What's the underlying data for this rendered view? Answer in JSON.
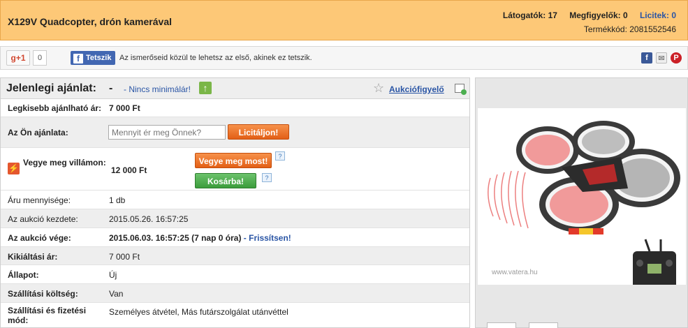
{
  "header": {
    "title": "X129V Quadcopter, drón kamerával",
    "visitors": "Látogatók: 17",
    "watchers": "Megfigyelők: 0",
    "bids": "Licitek: 0",
    "product_code": "Termékkód: 2081552546"
  },
  "social": {
    "gplus_label": "g+1",
    "gplus_count": "0",
    "fb_label": "Tetszik",
    "fb_icon": "f",
    "fb_text": "Az ismerőseid közül te lehetsz az első, akinek ez tetszik.",
    "share_fb": "f",
    "share_mail": "✉",
    "share_pin": "P"
  },
  "bid": {
    "current_label": "Jelenlegi ajánlat:",
    "current_value": "-",
    "no_minimum": "- Nincs minimálár!",
    "watch_label": "Aukciófigyelő",
    "min_bid_label": "Legkisebb ajánlható ár:",
    "min_bid_value": "7 000 Ft",
    "your_bid_label": "Az Ön ajánlata:",
    "your_bid_placeholder": "Mennyit ér meg Önnek?",
    "bid_button": "Licitáljon!",
    "buynow_label": "Vegye meg villámon:",
    "buynow_value": "12 000 Ft",
    "buynow_button": "Vegye meg most!",
    "cart_button": "Kosárba!",
    "help_mark": "?"
  },
  "details": [
    {
      "label": "Áru mennyisége:",
      "value": "1 db"
    },
    {
      "label": "Az aukció kezdete:",
      "value": "2015.05.26. 16:57:25"
    },
    {
      "label": "Az aukció vége:",
      "value": "2015.06.03. 16:57:25 (7 nap 0 óra)",
      "extra": " - Frissítsen!"
    },
    {
      "label": "Kikiáltási ár:",
      "value": "7 000 Ft"
    },
    {
      "label": "Állapot:",
      "value": "Új"
    },
    {
      "label": "Szállítási költség:",
      "value": "Van"
    },
    {
      "label": "Szállítási és fizetési mód:",
      "value": "Személyes átvétel, Más futárszolgálat utánvéttel"
    }
  ],
  "image": {
    "watermark": "www.vatera.hu"
  },
  "colors": {
    "header_bg": "#fdc877",
    "link": "#2a55a5",
    "orange_button": "#e35f16",
    "green_button": "#3b9c3b"
  }
}
